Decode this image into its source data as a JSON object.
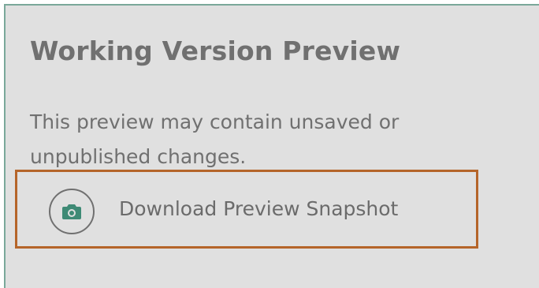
{
  "panel": {
    "title": "Working Version Preview",
    "description": "This preview may contain unsaved or unpublished changes.",
    "download_button": {
      "label": "Download Preview Snapshot",
      "icon": "camera-icon"
    }
  },
  "colors": {
    "panel_background": "#e0e0e0",
    "panel_border": "#7aa89a",
    "text": "#707070",
    "focus_outline": "#b5652a",
    "icon_fill": "#3e8a75"
  }
}
